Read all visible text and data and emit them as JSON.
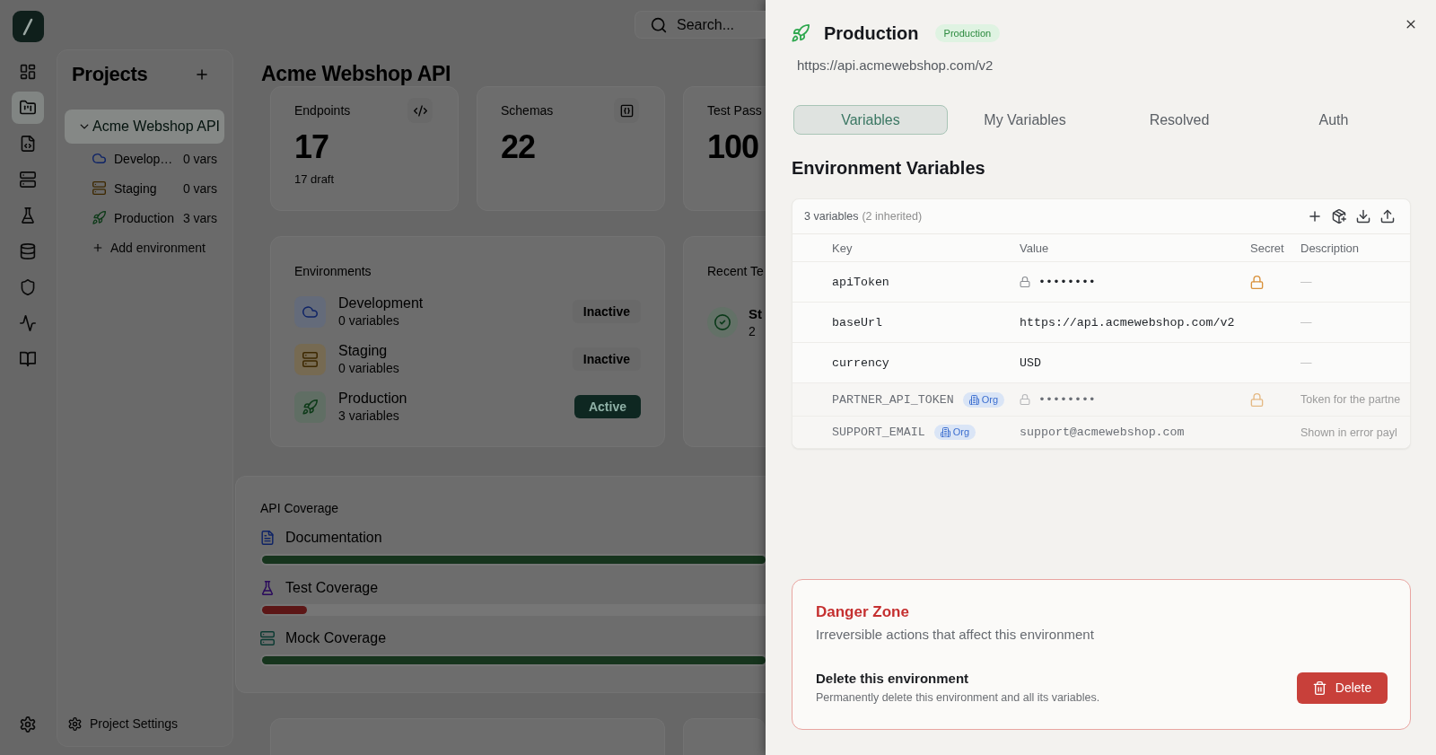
{
  "rail": {
    "items": [
      {
        "selected": false
      },
      {
        "selected": true
      },
      {
        "selected": false
      },
      {
        "selected": false
      },
      {
        "selected": false
      },
      {
        "selected": false
      },
      {
        "selected": false
      },
      {
        "selected": false
      },
      {
        "selected": false
      }
    ]
  },
  "projects_panel": {
    "title": "Projects",
    "project": {
      "name": "Acme Webshop API",
      "selected": true,
      "expanded": true,
      "environments": [
        {
          "name": "Develop…",
          "count": "0 vars"
        },
        {
          "name": "Staging",
          "count": "0 vars"
        },
        {
          "name": "Production",
          "count": "3 vars"
        }
      ]
    },
    "add_environment": "Add environment",
    "settings": "Project Settings"
  },
  "search": {
    "placeholder": "Search..."
  },
  "page_title": "Acme Webshop API",
  "stats": [
    {
      "label": "Endpoints",
      "value": "17",
      "note": "17 draft"
    },
    {
      "label": "Schemas",
      "value": "22"
    },
    {
      "label": "Test Pass",
      "value": "100"
    }
  ],
  "environments_card": {
    "title": "Environments",
    "items": [
      {
        "name": "Development",
        "count": "0 variables",
        "status": "Inactive",
        "active": false
      },
      {
        "name": "Staging",
        "count": "0 variables",
        "status": "Inactive",
        "active": false
      },
      {
        "name": "Production",
        "count": "3 variables",
        "status": "Active",
        "active": true
      }
    ]
  },
  "recent_card": {
    "title": "Recent Te",
    "items": [
      {
        "name": "St",
        "time": "2"
      }
    ]
  },
  "coverage_card": {
    "title": "API Coverage",
    "items": [
      {
        "label": "Documentation",
        "level": 1,
        "color": "#16341d"
      },
      {
        "label": "Test Coverage",
        "level": 0.09,
        "color": "#5c1616"
      },
      {
        "label": "Mock Coverage",
        "level": 1,
        "color": "#16341d"
      }
    ]
  },
  "drawer": {
    "title": "Production",
    "badge": "Production",
    "url": "https://api.acmewebshop.com/v2",
    "tabs": [
      {
        "label": "Variables",
        "selected": true
      },
      {
        "label": "My Variables",
        "selected": false
      },
      {
        "label": "Resolved",
        "selected": false
      },
      {
        "label": "Auth",
        "selected": false
      }
    ],
    "section_title": "Environment Variables",
    "table": {
      "summary": "3 variables",
      "summary_note": "(2 inherited)",
      "columns": [
        "Key",
        "Value",
        "Secret",
        "Description"
      ],
      "rows": [
        {
          "key": "apiToken",
          "value": "••••••••",
          "secret": true,
          "inherited": false,
          "description": "—"
        },
        {
          "key": "baseUrl",
          "value": "https://api.acmewebshop.com/v2",
          "secret": false,
          "inherited": false,
          "description": "—"
        },
        {
          "key": "currency",
          "value": "USD",
          "secret": false,
          "inherited": false,
          "description": "—"
        },
        {
          "key": "PARTNER_API_TOKEN",
          "badge": "Org",
          "value": "••••••••",
          "secret": true,
          "inherited": true,
          "description": "Token for the partne"
        },
        {
          "key": "SUPPORT_EMAIL",
          "badge": "Org",
          "value": "support@acmewebshop.com",
          "secret": false,
          "inherited": true,
          "description": "Shown in error payl"
        }
      ]
    },
    "danger_zone": {
      "title": "Danger Zone",
      "subtitle": "Irreversible actions that affect this environment",
      "action_title": "Delete this environment",
      "action_description": "Permanently delete this environment and all its variables.",
      "button": "Delete"
    }
  }
}
